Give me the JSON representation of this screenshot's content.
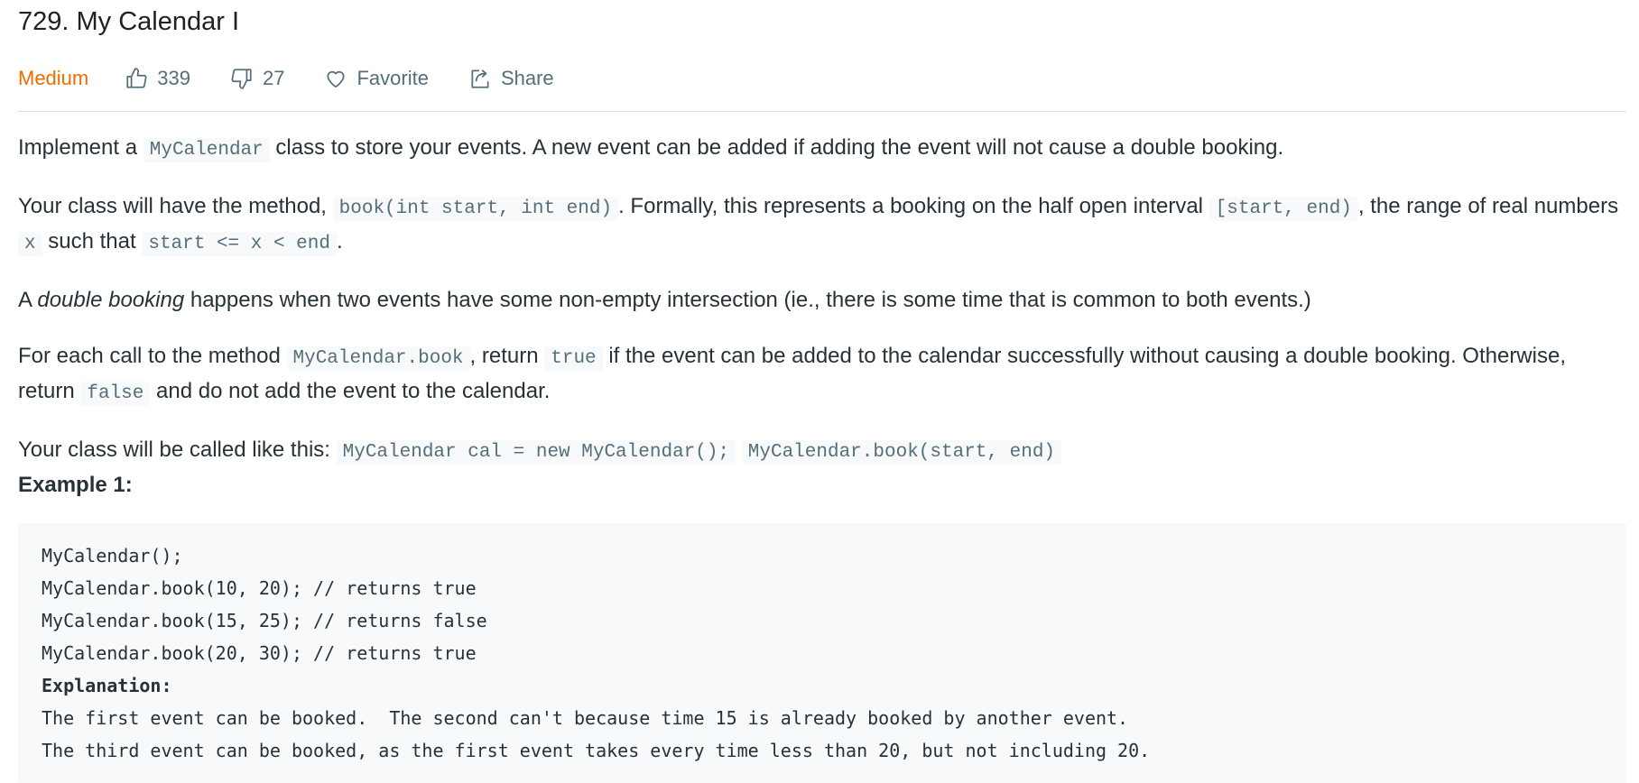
{
  "problem": {
    "title": "729. My Calendar I",
    "difficulty": "Medium",
    "likes": "339",
    "dislikes": "27",
    "favorite_label": "Favorite",
    "share_label": "Share"
  },
  "colors": {
    "difficulty": "#ef6c00",
    "meta_text": "#546e7a",
    "code_bg": "#f7f9fa",
    "text": "#263238"
  },
  "description": {
    "p1": {
      "t1": "Implement a ",
      "c1": "MyCalendar",
      "t2": " class to store your events. A new event can be added if adding the event will not cause a double booking."
    },
    "p2": {
      "t1": "Your class will have the method, ",
      "c1": "book(int start, int end)",
      "t2": ". Formally, this represents a booking on the half open interval ",
      "c2": "[start, end)",
      "t3": ", the range of real numbers ",
      "c3": "x",
      "t4": " such that ",
      "c4": "start <= x < end",
      "t5": "."
    },
    "p3": {
      "t1": "A ",
      "em1": "double booking",
      "t2": " happens when two events have some non-empty intersection (ie., there is some time that is common to both events.)"
    },
    "p4": {
      "t1": "For each call to the method ",
      "c1": "MyCalendar.book",
      "t2": ", return ",
      "c2": "true",
      "t3": " if the event can be added to the calendar successfully without causing a double booking. Otherwise, return ",
      "c3": "false",
      "t4": " and do not add the event to the calendar."
    },
    "p5": {
      "t1": "Your class will be called like this: ",
      "c1": "MyCalendar cal = new MyCalendar();",
      "t2": " ",
      "c2": "MyCalendar.book(start, end)"
    },
    "example_title": "Example 1:"
  },
  "example": {
    "lines": [
      "MyCalendar();",
      "MyCalendar.book(10, 20); // returns true",
      "MyCalendar.book(15, 25); // returns false",
      "MyCalendar.book(20, 30); // returns true"
    ],
    "explanation_label": "Explanation:",
    "explanation_lines": [
      "The first event can be booked.  The second can't because time 15 is already booked by another event.",
      "The third event can be booked, as the first event takes every time less than 20, but not including 20."
    ]
  }
}
